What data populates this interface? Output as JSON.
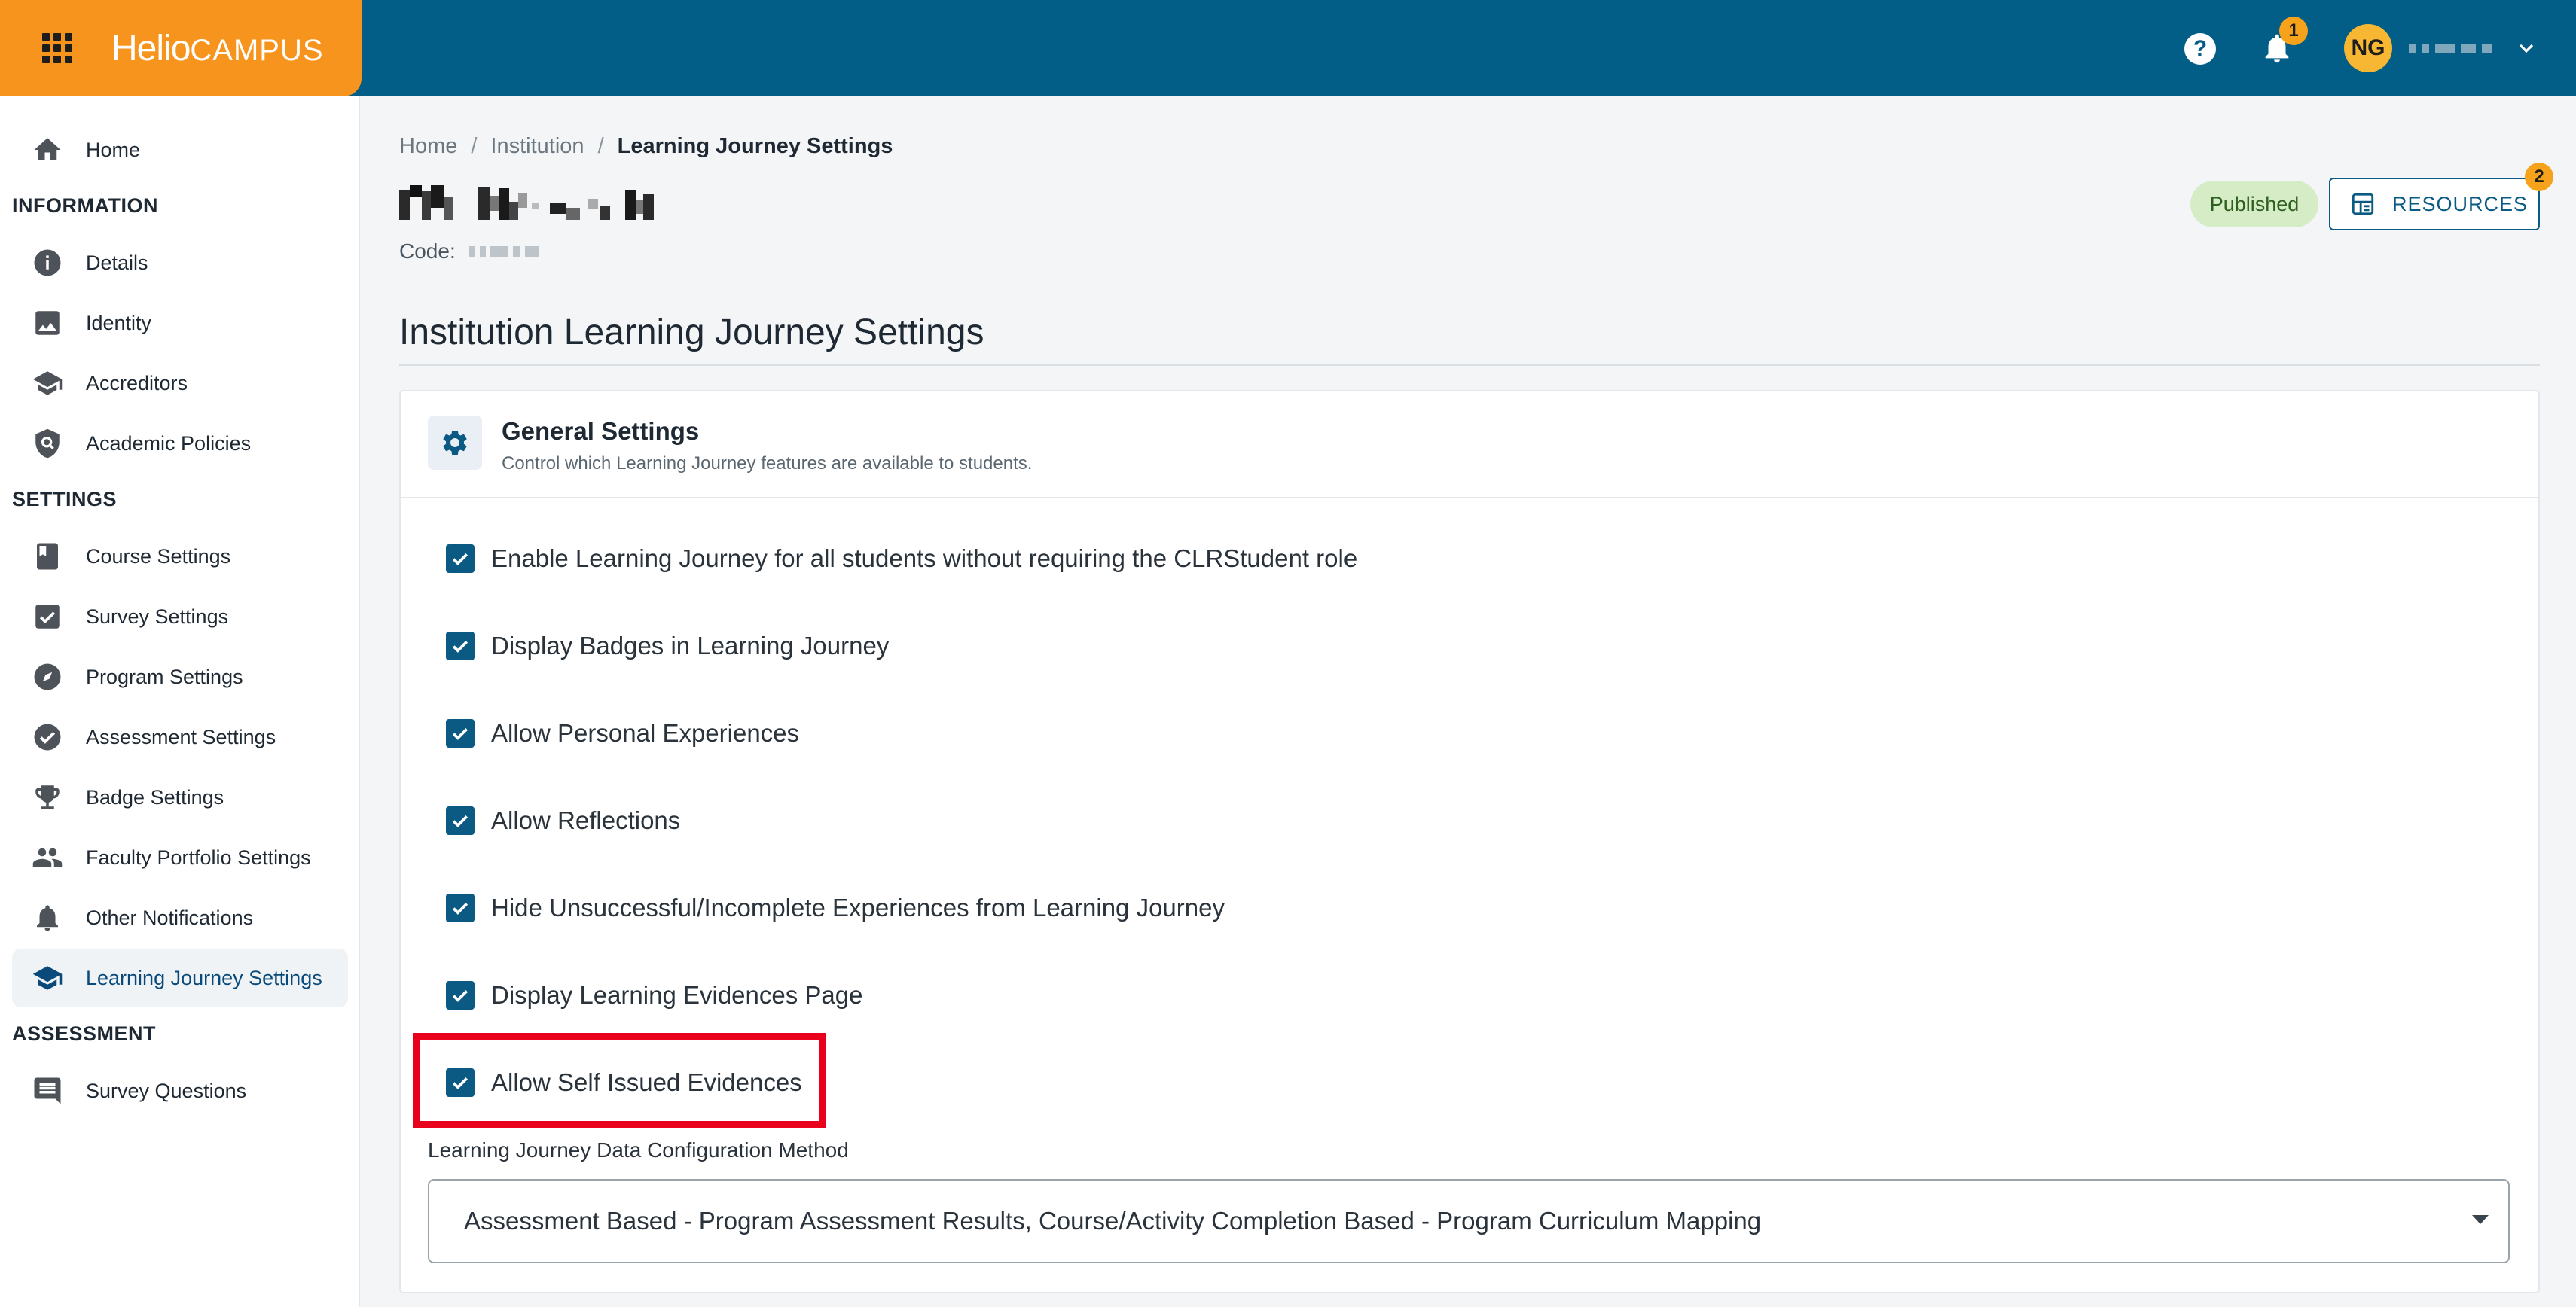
{
  "brand": {
    "logo_part1": "Helio",
    "logo_part2": "CAMPUS"
  },
  "header": {
    "help_label": "?",
    "notification_count": "1",
    "user_initials": "NG"
  },
  "sidebar": {
    "home": "Home",
    "information_section": "INFORMATION",
    "information_items": [
      "Details",
      "Identity",
      "Accreditors",
      "Academic Policies"
    ],
    "settings_section": "SETTINGS",
    "settings_items": [
      "Course Settings",
      "Survey Settings",
      "Program Settings",
      "Assessment Settings",
      "Badge Settings",
      "Faculty Portfolio Settings",
      "Other Notifications",
      "Learning Journey Settings"
    ],
    "assessment_section": "ASSESSMENT",
    "assessment_items": [
      "Survey Questions"
    ],
    "active_item": "Learning Journey Settings"
  },
  "breadcrumb": {
    "home": "Home",
    "institution": "Institution",
    "current": "Learning Journey Settings",
    "separator": "/"
  },
  "institution": {
    "code_label": "Code:"
  },
  "status": {
    "badge": "Published"
  },
  "resources": {
    "label": "RESOURCES",
    "badge_count": "2"
  },
  "page": {
    "title": "Institution Learning Journey Settings"
  },
  "general_settings": {
    "title": "General Settings",
    "subtitle": "Control which Learning Journey features are available to students.",
    "options": [
      {
        "label": "Enable Learning Journey for all students without requiring the CLRStudent role",
        "checked": true
      },
      {
        "label": "Display Badges in Learning Journey",
        "checked": true
      },
      {
        "label": "Allow Personal Experiences",
        "checked": true
      },
      {
        "label": "Allow Reflections",
        "checked": true
      },
      {
        "label": "Hide Unsuccessful/Incomplete Experiences from Learning Journey",
        "checked": true
      },
      {
        "label": "Display Learning Evidences Page",
        "checked": true
      },
      {
        "label": "Allow Self Issued Evidences",
        "checked": true
      }
    ],
    "config_method_label": "Learning Journey Data Configuration Method",
    "config_method_value": "Assessment Based - Program Assessment Results, Course/Activity Completion Based - Program Curriculum Mapping"
  },
  "colors": {
    "topbar": "#025e86",
    "brand": "#f7941d",
    "accent": "#0a5a84",
    "highlight": "#e8001c",
    "badge": "#f7a21b"
  }
}
